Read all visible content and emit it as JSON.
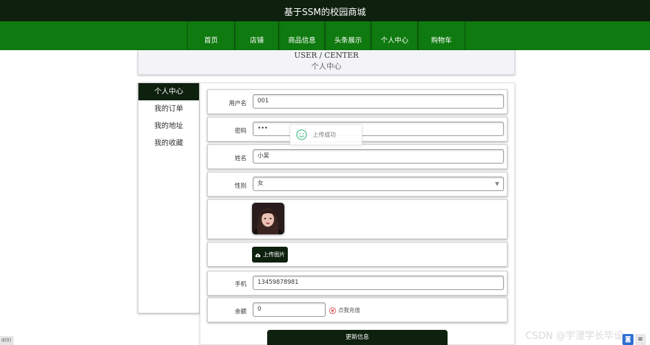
{
  "site": {
    "title": "基于SSM的校园商城"
  },
  "nav": {
    "items": [
      "首页",
      "店铺",
      "商品信息",
      "头条展示",
      "个人中心",
      "购物车"
    ]
  },
  "header": {
    "en": "USER / CENTER",
    "cn": "个人中心"
  },
  "sidebar": {
    "items": [
      "个人中心",
      "我的订单",
      "我的地址",
      "我的收藏"
    ]
  },
  "form": {
    "username": {
      "label": "用户名",
      "value": "001"
    },
    "password": {
      "label": "密码",
      "value": "•••"
    },
    "name": {
      "label": "姓名",
      "value": "小吴"
    },
    "gender": {
      "label": "性别",
      "value": "女"
    },
    "upload_label": "上传图片",
    "phone": {
      "label": "手机",
      "value": "13459878981"
    },
    "balance": {
      "label": "余额",
      "value": "0"
    },
    "recharge_label": "点我充值",
    "submit_label": "更新信息"
  },
  "toast": {
    "message": "上传成功"
  },
  "watermark": "CSDN @宇澄学长毕设",
  "status_tag": "d(0)",
  "colors": {
    "dark": "#0e200e",
    "nav_green": "#0f7a0f",
    "toast_icon": "#4cc38a",
    "recharge_icon": "#d23a3a"
  }
}
